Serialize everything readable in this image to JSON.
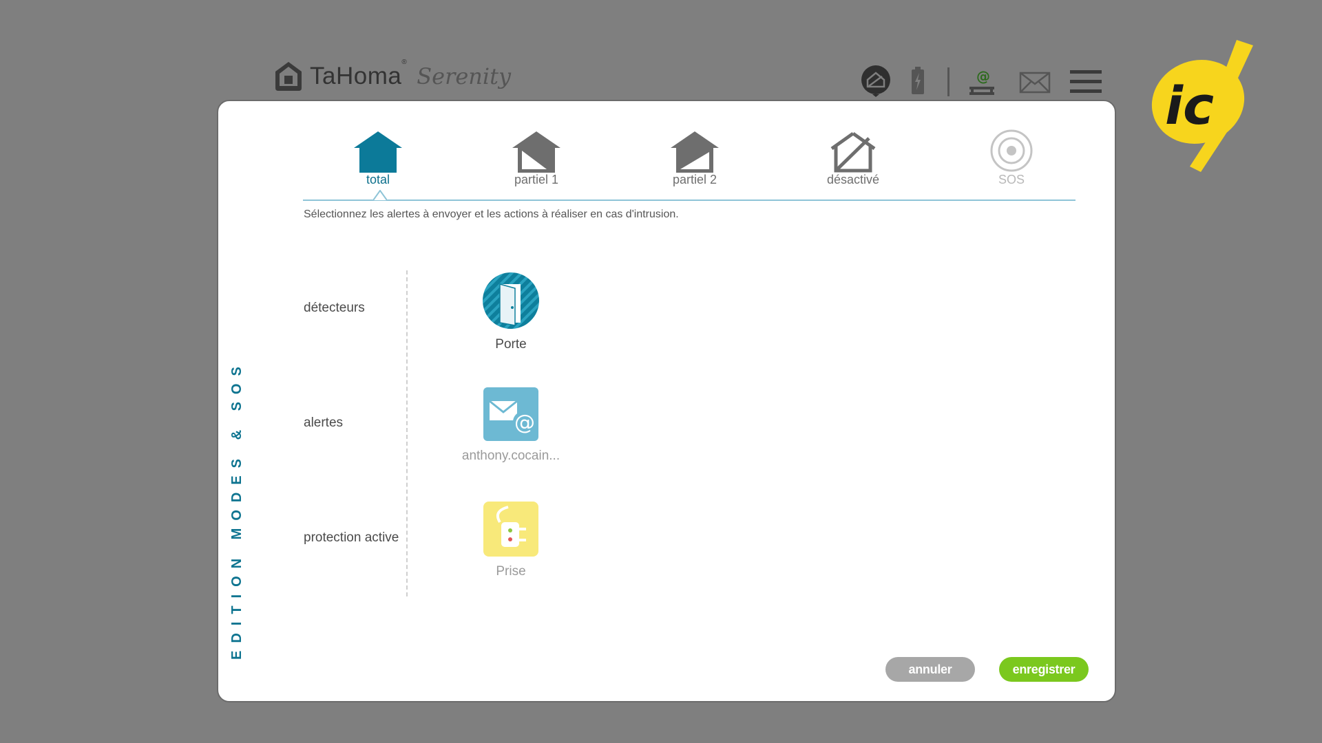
{
  "header": {
    "brand_main": "TaHoma",
    "brand_reg": "®",
    "brand_sub": "Serenity",
    "toolbar_icons": [
      "house-mode-icon",
      "battery-icon",
      "email-settings-icon",
      "mail-icon",
      "menu-icon"
    ]
  },
  "dialog": {
    "vertical_title": "EDITION MODES & SOS",
    "tabs": [
      {
        "label": "total",
        "icon": "house-full-icon",
        "state": "active"
      },
      {
        "label": "partiel 1",
        "icon": "house-partial-1-icon",
        "state": "normal"
      },
      {
        "label": "partiel 2",
        "icon": "house-partial-2-icon",
        "state": "normal"
      },
      {
        "label": "désactivé",
        "icon": "house-off-icon",
        "state": "normal"
      },
      {
        "label": "SOS",
        "icon": "sos-target-icon",
        "state": "disabled"
      }
    ],
    "instruction": "Sélectionnez les alertes à envoyer et les actions à réaliser en cas d'intrusion.",
    "sections": [
      {
        "label": "détecteurs",
        "device": {
          "label": "Porte",
          "icon": "door-sensor-icon"
        }
      },
      {
        "label": "alertes",
        "device": {
          "label": "anthony.cocain...",
          "icon": "email-alert-icon"
        }
      },
      {
        "label": "protection active",
        "device": {
          "label": "Prise",
          "icon": "plug-icon"
        }
      }
    ],
    "buttons": {
      "cancel": "annuler",
      "save": "enregistrer"
    }
  },
  "colors": {
    "accent": "#0c6f8c",
    "save": "#7bc81e",
    "cancel": "#a7a7a7",
    "badge": "#f7d51d"
  }
}
